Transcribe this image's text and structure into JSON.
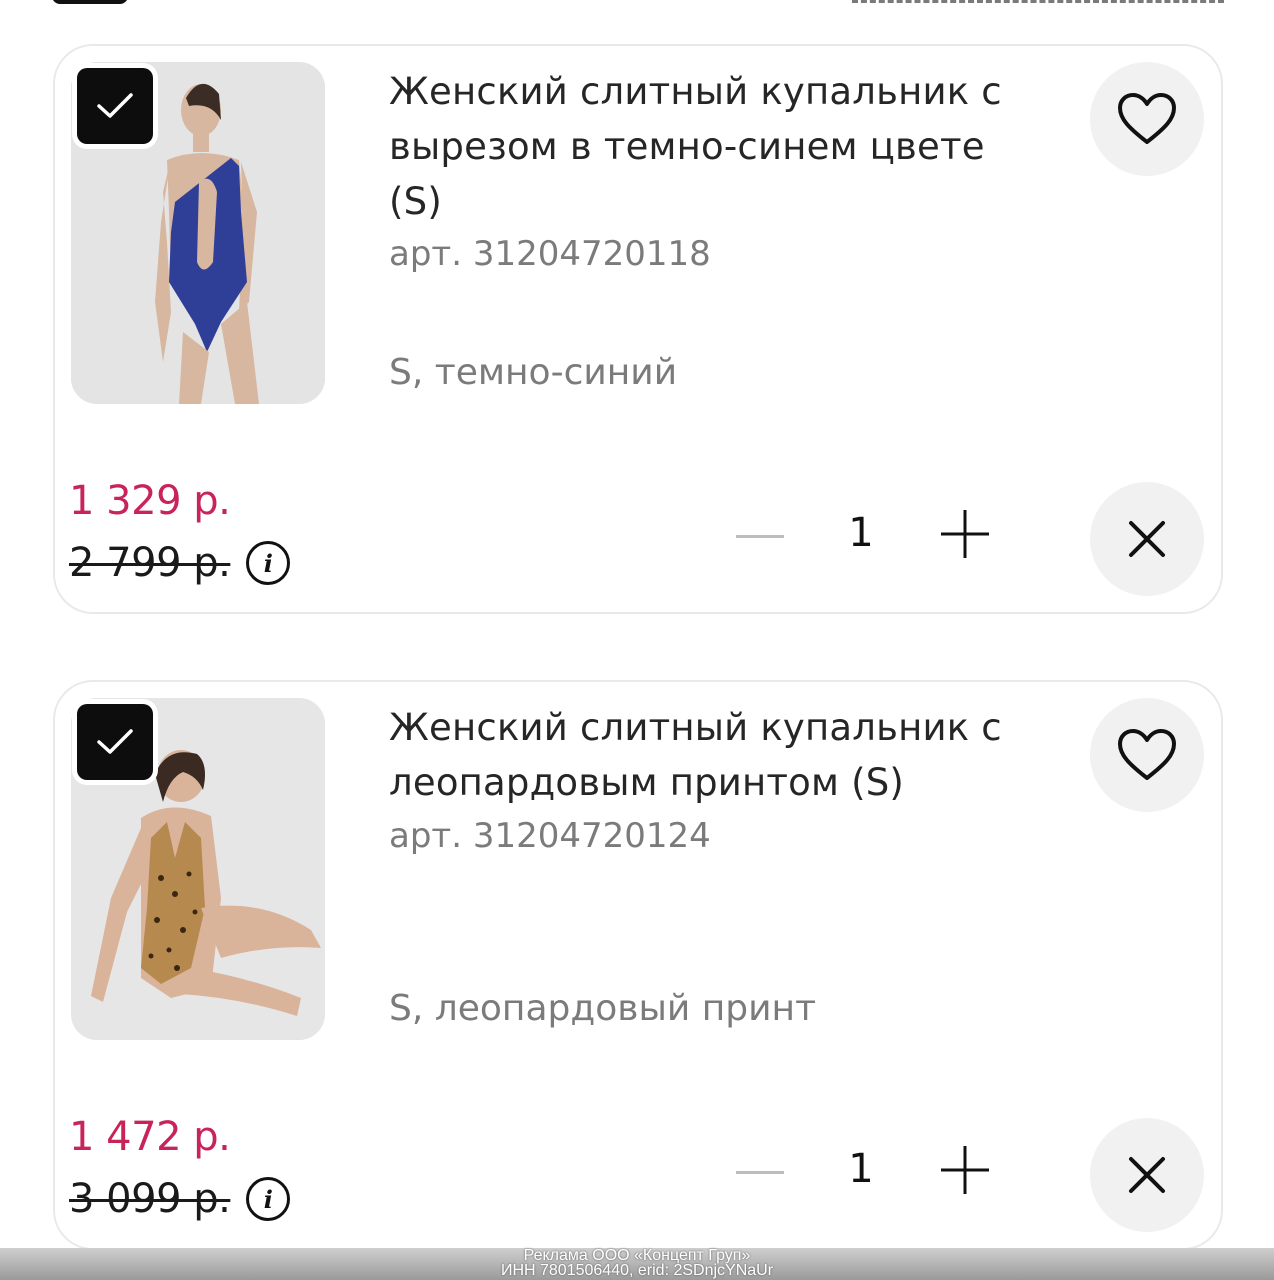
{
  "colors": {
    "accent_price": "#c8245a",
    "card_border": "#e9e9e9",
    "button_bg": "#f1f1f1"
  },
  "cart_items": [
    {
      "title": "Женский слитный купальник с вырезом в темно-синем цвете (S)",
      "sku": "арт. 31204720118",
      "variant": "S, темно-синий",
      "price_now": "1 329 р.",
      "price_old": "2 799 р.",
      "quantity": "1",
      "selected": true,
      "icons": {
        "check": "check-icon",
        "fav": "heart-icon",
        "remove": "close-icon",
        "minus": "minus-icon",
        "plus": "plus-icon",
        "info": "info-icon"
      }
    },
    {
      "title": "Женский слитный купальник с леопардовым принтом (S)",
      "sku": "арт. 31204720124",
      "variant": "S, леопардовый принт",
      "price_now": "1 472 р.",
      "price_old": "3 099 р.",
      "quantity": "1",
      "selected": true,
      "icons": {
        "check": "check-icon",
        "fav": "heart-icon",
        "remove": "close-icon",
        "minus": "minus-icon",
        "plus": "plus-icon",
        "info": "info-icon"
      }
    }
  ],
  "ad_notice": {
    "line1": "Реклама ООО «Концепт Груп»",
    "line2": "ИНН 7801506440, erid: 2SDnjcYNaUr"
  }
}
